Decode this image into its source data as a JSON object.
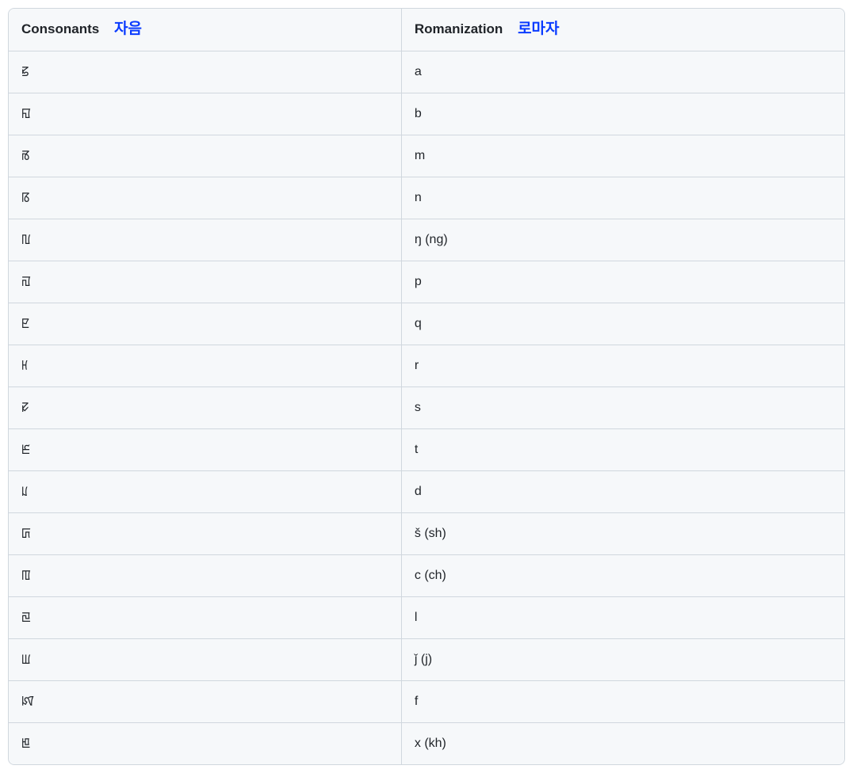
{
  "headers": {
    "col1_main": "Consonants",
    "col1_trans": "자음",
    "col2_main": "Romanization",
    "col2_trans": "로마자"
  },
  "rows": [
    {
      "consonant": "ꡝ",
      "roman": "a"
    },
    {
      "consonant": "ꡎ",
      "roman": "b"
    },
    {
      "consonant": "ꡏ",
      "roman": "m"
    },
    {
      "consonant": "ꡋ",
      "roman": "n"
    },
    {
      "consonant": "ꡃ",
      "roman": "ŋ (ng)"
    },
    {
      "consonant": "ꡌ",
      "roman": "p"
    },
    {
      "consonant": "ꡢ",
      "roman": "q"
    },
    {
      "consonant": "ꡘ",
      "roman": "r"
    },
    {
      "consonant": "ꡛ",
      "roman": "s"
    },
    {
      "consonant": "ꡈ",
      "roman": "t"
    },
    {
      "consonant": "ꡊ",
      "roman": "d"
    },
    {
      "consonant": "ꡚ",
      "roman": "š (sh)"
    },
    {
      "consonant": "ꡄ",
      "roman": "c (ch)"
    },
    {
      "consonant": "ꡙ",
      "roman": "l"
    },
    {
      "consonant": "ꡆ",
      "roman": "ǰ (j)"
    },
    {
      "consonant": "ꡤ",
      "roman": "f"
    },
    {
      "consonant": "ꡁ",
      "roman": "x (kh)"
    }
  ]
}
